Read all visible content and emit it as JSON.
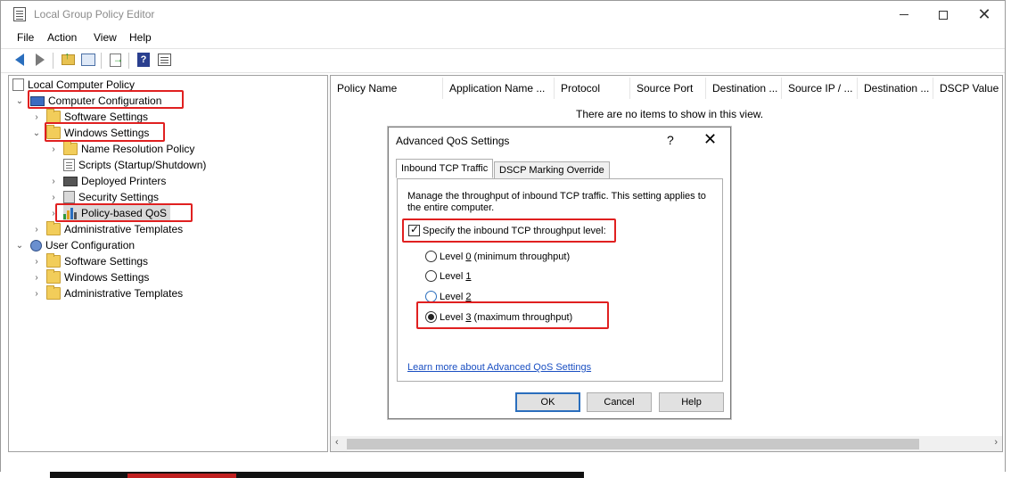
{
  "window": {
    "title": "Local Group Policy Editor"
  },
  "menubar": {
    "items": [
      "File",
      "Action",
      "View",
      "Help"
    ]
  },
  "tree": {
    "items": [
      {
        "label": "Local Computer Policy",
        "icon": "policy-icon"
      },
      {
        "label": "Computer Configuration",
        "icon": "computer-icon",
        "expanded": true,
        "highlighted": true
      },
      {
        "label": "Software Settings",
        "icon": "folder-icon"
      },
      {
        "label": "Windows Settings",
        "icon": "folder-icon",
        "expanded": true,
        "highlighted": true
      },
      {
        "label": "Name Resolution Policy",
        "icon": "folder-icon"
      },
      {
        "label": "Scripts (Startup/Shutdown)",
        "icon": "document-icon"
      },
      {
        "label": "Deployed Printers",
        "icon": "printer-icon"
      },
      {
        "label": "Security Settings",
        "icon": "security-icon"
      },
      {
        "label": "Policy-based QoS",
        "icon": "qos-chart-icon",
        "selected": true,
        "highlighted": true
      },
      {
        "label": "Administrative Templates",
        "icon": "folder-icon"
      },
      {
        "label": "User Configuration",
        "icon": "user-icon",
        "expanded": true
      },
      {
        "label": "Software Settings",
        "icon": "folder-icon"
      },
      {
        "label": "Windows Settings",
        "icon": "folder-icon"
      },
      {
        "label": "Administrative Templates",
        "icon": "folder-icon"
      }
    ]
  },
  "list": {
    "columns": [
      "Policy Name",
      "Application Name ...",
      "Protocol",
      "Source Port",
      "Destination ...",
      "Source IP / ...",
      "Destination ...",
      "DSCP Value"
    ],
    "empty_message": "There are no items to show in this view."
  },
  "dialog": {
    "title": "Advanced QoS Settings",
    "help_glyph": "?",
    "tabs": [
      "Inbound TCP Traffic",
      "DSCP Marking Override"
    ],
    "active_tab": "Inbound TCP Traffic",
    "description": "Manage the throughput of inbound TCP traffic. This setting applies to the entire computer.",
    "checkbox": {
      "label": "Specify the inbound TCP throughput level:",
      "checked": true
    },
    "radios": [
      {
        "prefix": "Level ",
        "key": "0",
        "suffix": " (minimum throughput)",
        "checked": false
      },
      {
        "prefix": "Level ",
        "key": "1",
        "suffix": "",
        "checked": false
      },
      {
        "prefix": "Level ",
        "key": "2",
        "suffix": "",
        "checked": false
      },
      {
        "prefix": "Level ",
        "key": "3",
        "suffix": " (maximum throughput)",
        "checked": true
      }
    ],
    "link": "Learn more about Advanced QoS Settings",
    "buttons": {
      "ok": "OK",
      "cancel": "Cancel",
      "help": "Help"
    }
  },
  "colors": {
    "highlight_box": "#e02020",
    "link": "#1a4fc2",
    "accent": "#2a6ebd"
  }
}
